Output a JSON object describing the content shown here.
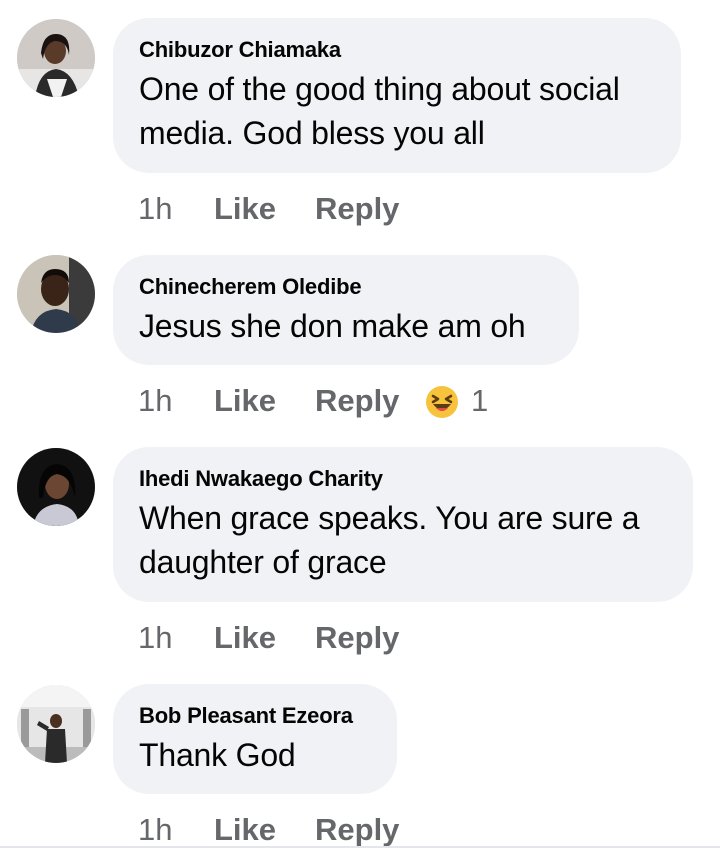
{
  "comments": [
    {
      "author": "Chibuzor Chiamaka",
      "text_lines": [
        "One of the good thing about social",
        "media. God bless you all"
      ],
      "time": "1h",
      "like_label": "Like",
      "reply_label": "Reply"
    },
    {
      "author": "Chinecherem Oledibe",
      "text_lines": [
        "Jesus she don make am oh"
      ],
      "time": "1h",
      "like_label": "Like",
      "reply_label": "Reply",
      "reaction": {
        "icon": "laughing-emoji-icon",
        "count": "1"
      }
    },
    {
      "author": "Ihedi Nwakaego Charity",
      "text_lines": [
        "When grace speaks. You are sure a",
        "daughter of grace"
      ],
      "time": "1h",
      "like_label": "Like",
      "reply_label": "Reply"
    },
    {
      "author": "Bob Pleasant Ezeora",
      "text_lines": [
        "Thank God"
      ],
      "time": "1h",
      "like_label": "Like",
      "reply_label": "Reply"
    }
  ],
  "colors": {
    "bubble": "#f0f2f5",
    "text": "#050505",
    "meta": "#65676b"
  }
}
